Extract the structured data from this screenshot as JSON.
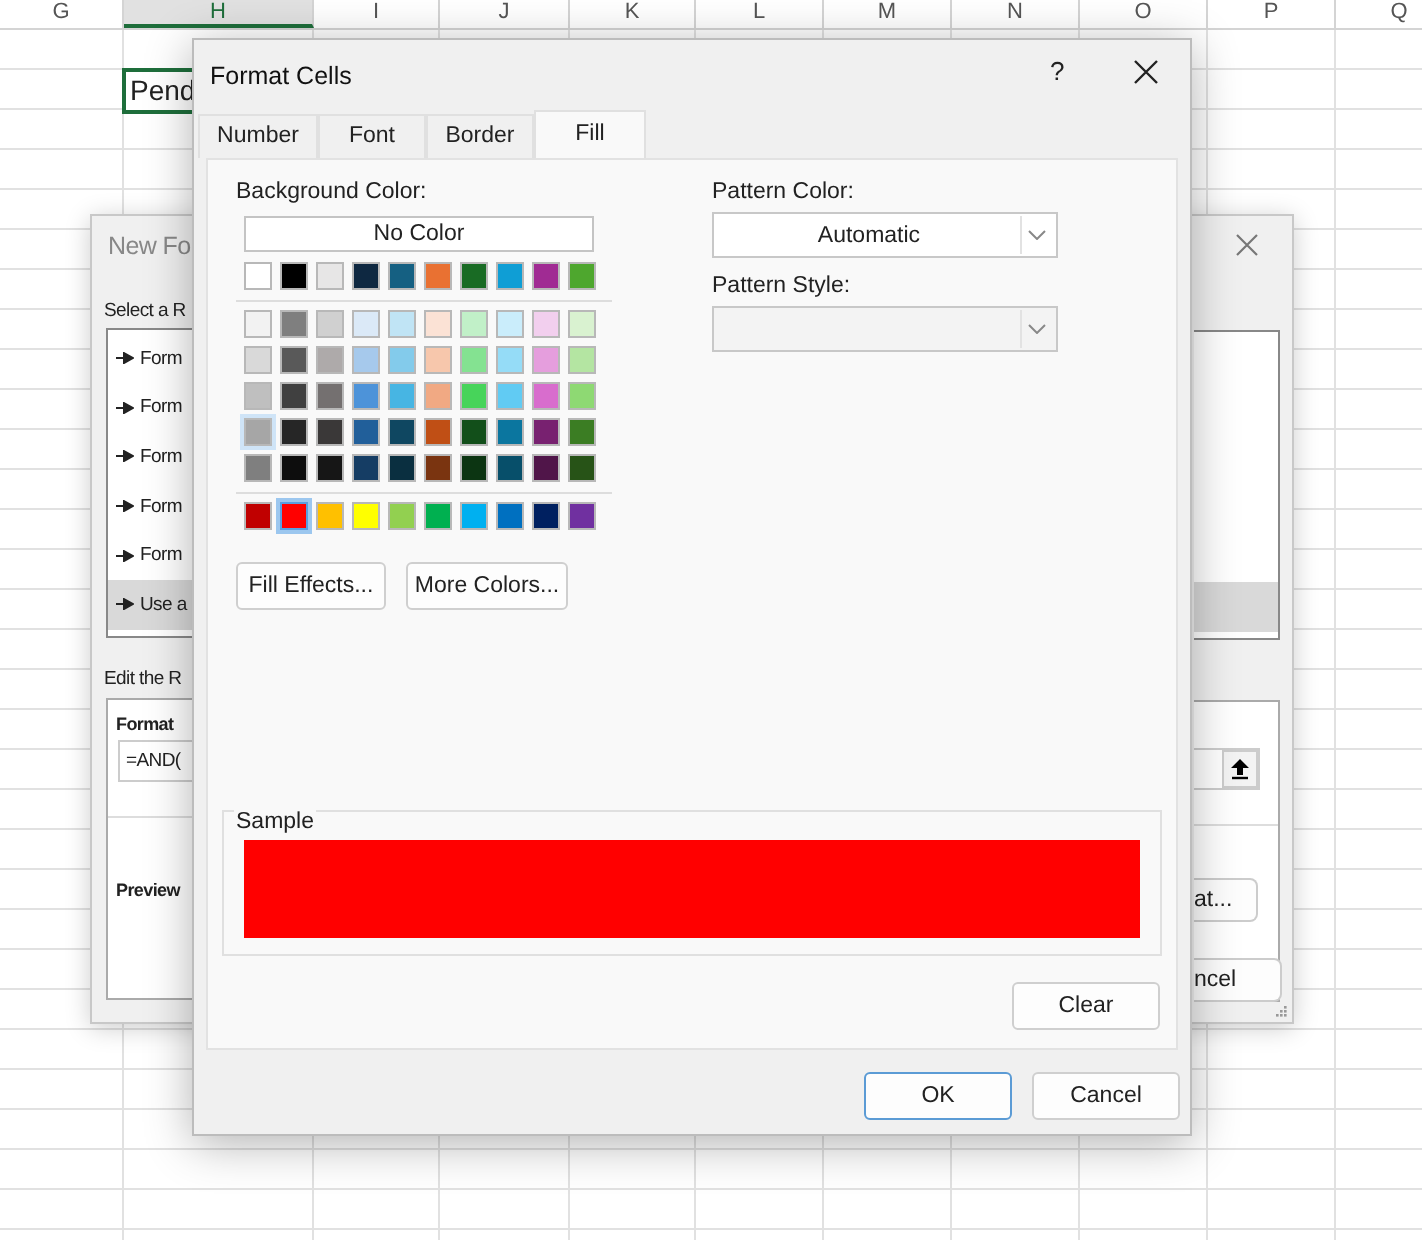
{
  "spreadsheet": {
    "columns": [
      {
        "label": "G",
        "selected": false
      },
      {
        "label": "H",
        "selected": true
      },
      {
        "label": "I",
        "selected": false
      },
      {
        "label": "J",
        "selected": false
      },
      {
        "label": "K",
        "selected": false
      },
      {
        "label": "L",
        "selected": false
      },
      {
        "label": "M",
        "selected": false
      },
      {
        "label": "N",
        "selected": false
      },
      {
        "label": "O",
        "selected": false
      },
      {
        "label": "P",
        "selected": false
      },
      {
        "label": "Q",
        "selected": false
      }
    ],
    "active_cell": {
      "value": "Pend"
    }
  },
  "background_dialog": {
    "title": "New Fo",
    "select_label": "Select a R",
    "rule_types": [
      {
        "label": "Form",
        "selected": false
      },
      {
        "label": "Form",
        "selected": false
      },
      {
        "label": "Form",
        "selected": false
      },
      {
        "label": "Form",
        "selected": false
      },
      {
        "label": "Form",
        "selected": false
      },
      {
        "label": "Use a",
        "selected": true
      }
    ],
    "edit_label": "Edit the R",
    "format_label": "Format",
    "formula": "=AND(",
    "preview_label": "Preview",
    "format_button": "at...",
    "cancel_button": "ncel"
  },
  "dialog": {
    "title": "Format Cells",
    "help": "?",
    "tabs": [
      {
        "label": "Number",
        "selected": false
      },
      {
        "label": "Font",
        "selected": false
      },
      {
        "label": "Border",
        "selected": false
      },
      {
        "label": "Fill",
        "selected": true
      }
    ],
    "background_color_label": "Background Color:",
    "no_color_button": "No Color",
    "theme_colors": [
      {
        "color": "#ffffff",
        "selected": false,
        "hovered": false
      },
      {
        "color": "#000000",
        "selected": false,
        "hovered": false
      },
      {
        "color": "#e7e6e6",
        "selected": false,
        "hovered": false
      },
      {
        "color": "#0e2841",
        "selected": false,
        "hovered": false
      },
      {
        "color": "#156082",
        "selected": false,
        "hovered": false
      },
      {
        "color": "#e97132",
        "selected": false,
        "hovered": false
      },
      {
        "color": "#196b24",
        "selected": false,
        "hovered": false
      },
      {
        "color": "#0f9ed5",
        "selected": false,
        "hovered": false
      },
      {
        "color": "#a02b93",
        "selected": false,
        "hovered": false
      },
      {
        "color": "#4ea72e",
        "selected": false,
        "hovered": false
      }
    ],
    "shade_rows": [
      [
        {
          "color": "#f2f2f2",
          "selected": false,
          "hovered": false
        },
        {
          "color": "#7f7f7f",
          "selected": false,
          "hovered": false
        },
        {
          "color": "#d0d0d0",
          "selected": false,
          "hovered": false
        },
        {
          "color": "#dbe9f7",
          "selected": false,
          "hovered": false
        },
        {
          "color": "#c0e4f5",
          "selected": false,
          "hovered": false
        },
        {
          "color": "#fbe2d5",
          "selected": false,
          "hovered": false
        },
        {
          "color": "#c1f0c8",
          "selected": false,
          "hovered": false
        },
        {
          "color": "#caedfb",
          "selected": false,
          "hovered": false
        },
        {
          "color": "#f2cfee",
          "selected": false,
          "hovered": false
        },
        {
          "color": "#d9f2d0",
          "selected": false,
          "hovered": false
        }
      ],
      [
        {
          "color": "#d9d9d9",
          "selected": false,
          "hovered": false
        },
        {
          "color": "#595959",
          "selected": false,
          "hovered": false
        },
        {
          "color": "#aeaaaa",
          "selected": false,
          "hovered": false
        },
        {
          "color": "#a6c9ec",
          "selected": false,
          "hovered": false
        },
        {
          "color": "#83cbeb",
          "selected": false,
          "hovered": false
        },
        {
          "color": "#f7c7ac",
          "selected": false,
          "hovered": false
        },
        {
          "color": "#84e291",
          "selected": false,
          "hovered": false
        },
        {
          "color": "#95dcf7",
          "selected": false,
          "hovered": false
        },
        {
          "color": "#e59edd",
          "selected": false,
          "hovered": false
        },
        {
          "color": "#b4e5a2",
          "selected": false,
          "hovered": false
        }
      ],
      [
        {
          "color": "#bfbfbf",
          "selected": false,
          "hovered": false
        },
        {
          "color": "#404040",
          "selected": false,
          "hovered": false
        },
        {
          "color": "#747070",
          "selected": false,
          "hovered": false
        },
        {
          "color": "#4d93d9",
          "selected": false,
          "hovered": false
        },
        {
          "color": "#47b5e3",
          "selected": false,
          "hovered": false
        },
        {
          "color": "#f1a983",
          "selected": false,
          "hovered": false
        },
        {
          "color": "#47d45a",
          "selected": false,
          "hovered": false
        },
        {
          "color": "#61cbf3",
          "selected": false,
          "hovered": false
        },
        {
          "color": "#d86dcd",
          "selected": false,
          "hovered": false
        },
        {
          "color": "#8ed973",
          "selected": false,
          "hovered": false
        }
      ],
      [
        {
          "color": "#a6a6a6",
          "selected": false,
          "hovered": true
        },
        {
          "color": "#262626",
          "selected": false,
          "hovered": false
        },
        {
          "color": "#3a3838",
          "selected": false,
          "hovered": false
        },
        {
          "color": "#215f9a",
          "selected": false,
          "hovered": false
        },
        {
          "color": "#0f4761",
          "selected": false,
          "hovered": false
        },
        {
          "color": "#c04f15",
          "selected": false,
          "hovered": false
        },
        {
          "color": "#124f1a",
          "selected": false,
          "hovered": false
        },
        {
          "color": "#0b769f",
          "selected": false,
          "hovered": false
        },
        {
          "color": "#782170",
          "selected": false,
          "hovered": false
        },
        {
          "color": "#3b7d23",
          "selected": false,
          "hovered": false
        }
      ],
      [
        {
          "color": "#7f7f7f",
          "selected": false,
          "hovered": false
        },
        {
          "color": "#0d0d0d",
          "selected": false,
          "hovered": false
        },
        {
          "color": "#161616",
          "selected": false,
          "hovered": false
        },
        {
          "color": "#153d64",
          "selected": false,
          "hovered": false
        },
        {
          "color": "#0a2f40",
          "selected": false,
          "hovered": false
        },
        {
          "color": "#7a3410",
          "selected": false,
          "hovered": false
        },
        {
          "color": "#0c3512",
          "selected": false,
          "hovered": false
        },
        {
          "color": "#074f6a",
          "selected": false,
          "hovered": false
        },
        {
          "color": "#501549",
          "selected": false,
          "hovered": false
        },
        {
          "color": "#275317",
          "selected": false,
          "hovered": false
        }
      ]
    ],
    "standard_colors": [
      {
        "color": "#c00000",
        "selected": false,
        "hovered": false
      },
      {
        "color": "#ff0000",
        "selected": true,
        "hovered": false
      },
      {
        "color": "#ffc000",
        "selected": false,
        "hovered": false
      },
      {
        "color": "#ffff00",
        "selected": false,
        "hovered": false
      },
      {
        "color": "#92d050",
        "selected": false,
        "hovered": false
      },
      {
        "color": "#00b050",
        "selected": false,
        "hovered": false
      },
      {
        "color": "#00b0f0",
        "selected": false,
        "hovered": false
      },
      {
        "color": "#0070c0",
        "selected": false,
        "hovered": false
      },
      {
        "color": "#002060",
        "selected": false,
        "hovered": false
      },
      {
        "color": "#7030a0",
        "selected": false,
        "hovered": false
      }
    ],
    "fill_effects_button": "Fill Effects...",
    "more_colors_button": "More Colors...",
    "pattern_color_label": "Pattern Color:",
    "pattern_color": "Automatic",
    "pattern_style_label": "Pattern Style:",
    "sample": {
      "label": "Sample",
      "color": "#ff0000"
    },
    "clear_button": "Clear",
    "ok_button": "OK",
    "cancel_button": "Cancel"
  }
}
